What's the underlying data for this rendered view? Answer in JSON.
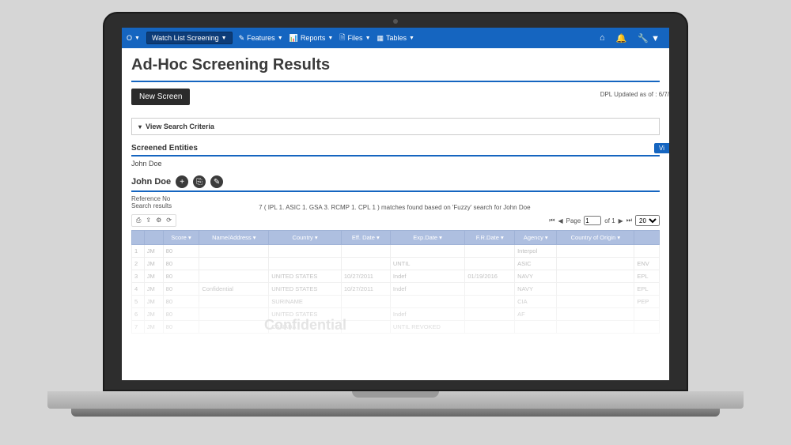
{
  "nav": {
    "brand_fragment": "O",
    "main": "Watch List Screening",
    "items": [
      "Features",
      "Reports",
      "Files",
      "Tables"
    ],
    "icons": {
      "home": "⌂",
      "bell": "🔔",
      "wrench": "🔧"
    }
  },
  "page": {
    "title": "Ad-Hoc Screening Results",
    "new_screen": "New Screen",
    "updated": "DPL Updated as of : 6/7/",
    "view_criteria": "View Search Criteria",
    "screened_entities": "Screened Entities",
    "view_btn": "Vi",
    "entity_name": "John Doe",
    "entity_header": "John Doe",
    "reference_label": "Reference No",
    "search_results_label": "Search results",
    "summary": "7 ( IPL 1. ASIC 1. GSA 3. RCMP 1. CPL 1 )  matches found based on  'Fuzzy'  search for  John Doe",
    "page_label": "Page",
    "of_label": "of 1",
    "page_value": "1",
    "per_page": "20"
  },
  "columns": [
    "",
    "",
    "Score",
    "Name/Address",
    "Country",
    "Eff. Date",
    "Exp.Date",
    "F.R.Date",
    "Agency",
    "Country of Origin",
    ""
  ],
  "rows": [
    {
      "n": "1",
      "badge": "JM",
      "score": "80",
      "name": "",
      "country": "",
      "eff": "",
      "exp": "",
      "fr": "",
      "agency": "Interpol",
      "origin": "",
      "last": ""
    },
    {
      "n": "2",
      "badge": "JM",
      "score": "80",
      "name": "",
      "country": "",
      "eff": "",
      "exp": "UNTIL",
      "fr": "",
      "agency": "ASIC",
      "origin": "",
      "last": "ENV"
    },
    {
      "n": "3",
      "badge": "JM",
      "score": "80",
      "name": "",
      "country": "UNITED STATES",
      "eff": "10/27/2011",
      "exp": "Indef",
      "fr": "01/19/2016",
      "agency": "NAVY",
      "origin": "",
      "last": "EPL"
    },
    {
      "n": "4",
      "badge": "JM",
      "score": "80",
      "name": "Confidential",
      "country": "UNITED STATES",
      "eff": "10/27/2011",
      "exp": "Indef",
      "fr": "",
      "agency": "NAVY",
      "origin": "",
      "last": "EPL"
    },
    {
      "n": "5",
      "badge": "JM",
      "score": "80",
      "name": "",
      "country": "SURINAME",
      "eff": "",
      "exp": "",
      "fr": "",
      "agency": "CIA",
      "origin": "",
      "last": "PEP"
    },
    {
      "n": "6",
      "badge": "JM",
      "score": "80",
      "name": "",
      "country": "UNITED STATES",
      "eff": "",
      "exp": "Indef",
      "fr": "",
      "agency": "AF",
      "origin": "",
      "last": ""
    },
    {
      "n": "7",
      "badge": "JM",
      "score": "80",
      "name": "",
      "country": "CANADA",
      "eff": "",
      "exp": "UNTIL REVOKED",
      "fr": "",
      "agency": "",
      "origin": "",
      "last": ""
    }
  ],
  "watermark": "Confidential"
}
